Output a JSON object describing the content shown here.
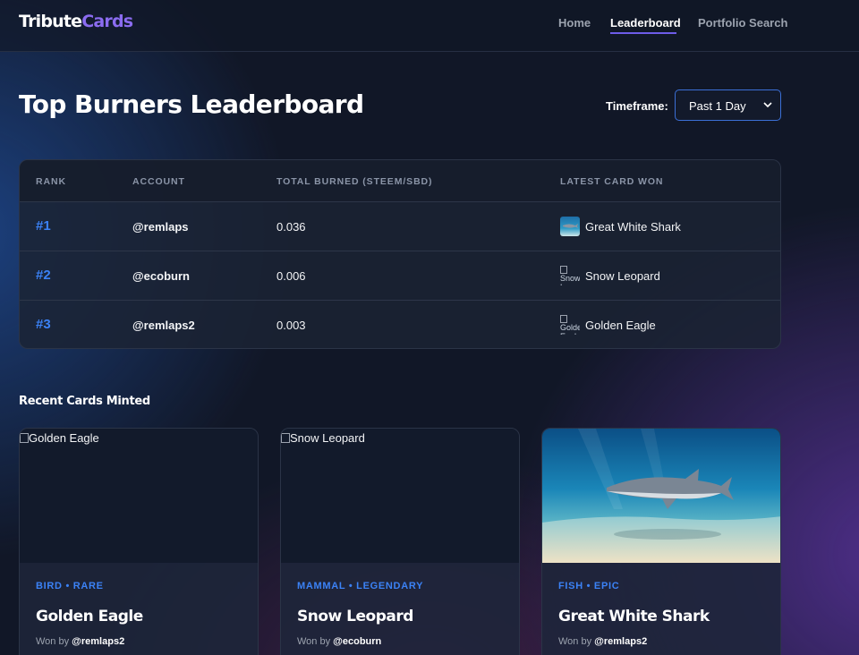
{
  "brand": {
    "part1": "Tribute",
    "part2": "Cards",
    "accent": "#8b6cf0"
  },
  "nav": {
    "home": "Home",
    "leaderboard": "Leaderboard",
    "portfolio": "Portfolio Search"
  },
  "page_title": "Top Burners Leaderboard",
  "timeframe": {
    "label": "Timeframe:",
    "selected": "Past 1 Day"
  },
  "table": {
    "headers": [
      "RANK",
      "ACCOUNT",
      "TOTAL BURNED (STEEM/SBD)",
      "LATEST CARD WON"
    ],
    "rows": [
      {
        "rank": "#1",
        "account": "@remlaps",
        "burned": "0.036",
        "card": "Great White Shark",
        "card_alt": ""
      },
      {
        "rank": "#2",
        "account": "@ecoburn",
        "burned": "0.006",
        "card": "Snow Leopard",
        "card_alt": "Snow Leopard"
      },
      {
        "rank": "#3",
        "account": "@remlaps2",
        "burned": "0.003",
        "card": "Golden Eagle",
        "card_alt": "Golden Eagle"
      }
    ]
  },
  "recent_title": "Recent Cards Minted",
  "cards": [
    {
      "alt": "Golden Eagle",
      "meta": "BIRD • RARE",
      "name": "Golden Eagle",
      "won_prefix": "Won by",
      "winner": "@remlaps2"
    },
    {
      "alt": "Snow Leopard",
      "meta": "MAMMAL • LEGENDARY",
      "name": "Snow Leopard",
      "won_prefix": "Won by",
      "winner": "@ecoburn"
    },
    {
      "alt": "",
      "meta": "FISH • EPIC",
      "name": "Great White Shark",
      "won_prefix": "Won by",
      "winner": "@remlaps2"
    }
  ],
  "colors": {
    "rank": "#3b82f6",
    "page_bg": "#111727",
    "select_border": "#3b6fd6"
  }
}
